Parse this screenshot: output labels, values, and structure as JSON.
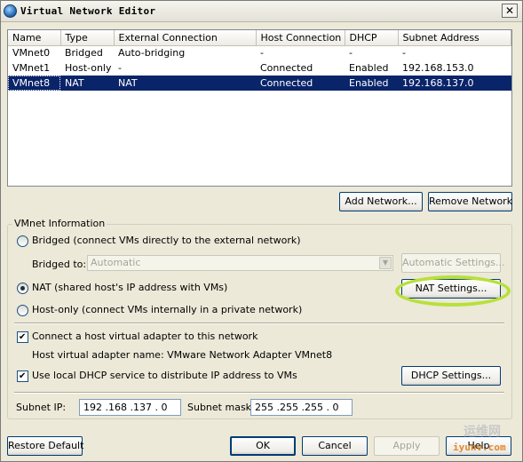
{
  "window": {
    "title": "Virtual Network Editor",
    "close_glyph": "✕",
    "icon": "network-globe-icon"
  },
  "table": {
    "columns": [
      "Name",
      "Type",
      "External Connection",
      "Host Connection",
      "DHCP",
      "Subnet Address"
    ],
    "rows": [
      {
        "name": "VMnet0",
        "type": "Bridged",
        "external": "Auto-bridging",
        "host": "-",
        "dhcp": "-",
        "subnet": "-"
      },
      {
        "name": "VMnet1",
        "type": "Host-only",
        "external": "-",
        "host": "Connected",
        "dhcp": "Enabled",
        "subnet": "192.168.153.0"
      },
      {
        "name": "VMnet8",
        "type": "NAT",
        "external": "NAT",
        "host": "Connected",
        "dhcp": "Enabled",
        "subnet": "192.168.137.0",
        "selected": true
      }
    ]
  },
  "buttons": {
    "add_network": "Add Network...",
    "remove_network": "Remove Network",
    "automatic_settings": "Automatic Settings...",
    "nat_settings": "NAT Settings...",
    "dhcp_settings": "DHCP Settings...",
    "restore_default": "Restore Default",
    "ok": "OK",
    "cancel": "Cancel",
    "apply": "Apply",
    "help": "Help"
  },
  "vmnet_info": {
    "legend": "VMnet Information",
    "bridged_label": "Bridged (connect VMs directly to the external network)",
    "bridged_to_label": "Bridged to:",
    "bridged_to_value": "Automatic",
    "nat_label": "NAT (shared host's IP address with VMs)",
    "hostonly_label": "Host-only (connect VMs internally in a private network)",
    "selected_mode": "NAT",
    "connect_adapter_label": "Connect a host virtual adapter to this network",
    "connect_adapter_checked": true,
    "adapter_name_text": "Host virtual adapter name: VMware Network Adapter VMnet8",
    "dhcp_label": "Use local DHCP service to distribute IP address to VMs",
    "dhcp_checked": true,
    "subnet_ip_label": "Subnet IP:",
    "subnet_ip_value": "192 .168 .137 . 0",
    "subnet_mask_label": "Subnet mask:",
    "subnet_mask_value": "255 .255 .255 . 0"
  },
  "watermark": {
    "text": "运维网",
    "url": "iyunv.com"
  },
  "colors": {
    "selection": "#0a246a",
    "highlight_ring": "#b8e03a",
    "window_bg": "#ece9d8"
  }
}
